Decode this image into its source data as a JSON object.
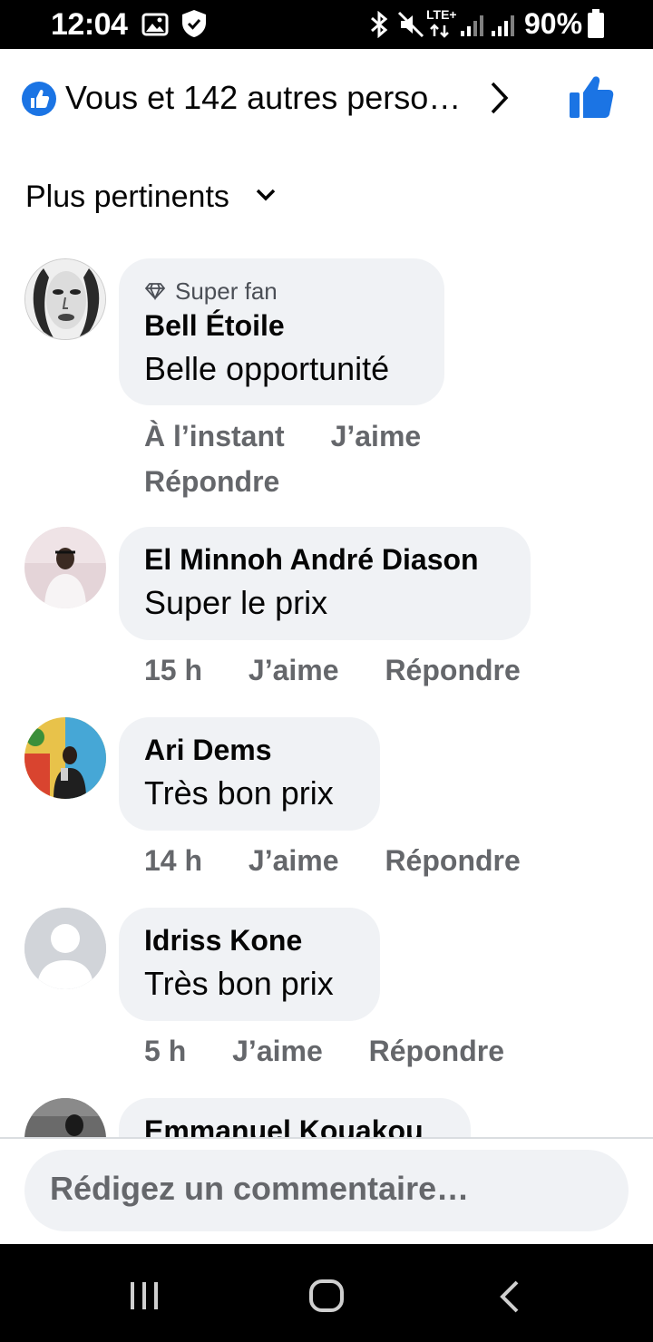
{
  "status_bar": {
    "time": "12:04",
    "battery": "90%",
    "icons": [
      "image-icon",
      "shield-icon",
      "bluetooth-icon",
      "mute-icon",
      "lte-icon",
      "signal-icon",
      "signal-icon",
      "battery-icon"
    ],
    "lte_label": "LTE+"
  },
  "reactions": {
    "summary": "Vous et 142 autres perso…",
    "icons": [
      "like-badge-icon",
      "chevron-right-icon",
      "thumbs-up-icon"
    ],
    "accent": "#1b74e4"
  },
  "sort": {
    "label": "Plus pertinents",
    "icon": "chevron-down-icon"
  },
  "comments": [
    {
      "badge": "Super fan",
      "badge_icon": "diamond-icon",
      "author": "Bell Étoile",
      "text": "Belle opportunité",
      "time": "À l’instant",
      "like": "J’aime",
      "reply": "Répondre"
    },
    {
      "author": "El Minnoh André Diason",
      "text": "Super le prix",
      "time": "15 h",
      "like": "J’aime",
      "reply": "Répondre"
    },
    {
      "author": "Ari Dems",
      "text": "Très bon prix",
      "time": "14 h",
      "like": "J’aime",
      "reply": "Répondre"
    },
    {
      "author": "Idriss Kone",
      "text": "Très bon prix",
      "time": "5 h",
      "like": "J’aime",
      "reply": "Répondre"
    },
    {
      "author": "Emmanuel Kouakou"
    }
  ],
  "composer": {
    "placeholder": "Rédigez un commentaire…"
  },
  "nav_bar": {
    "icons": [
      "recent-apps-icon",
      "home-icon",
      "back-icon"
    ]
  }
}
